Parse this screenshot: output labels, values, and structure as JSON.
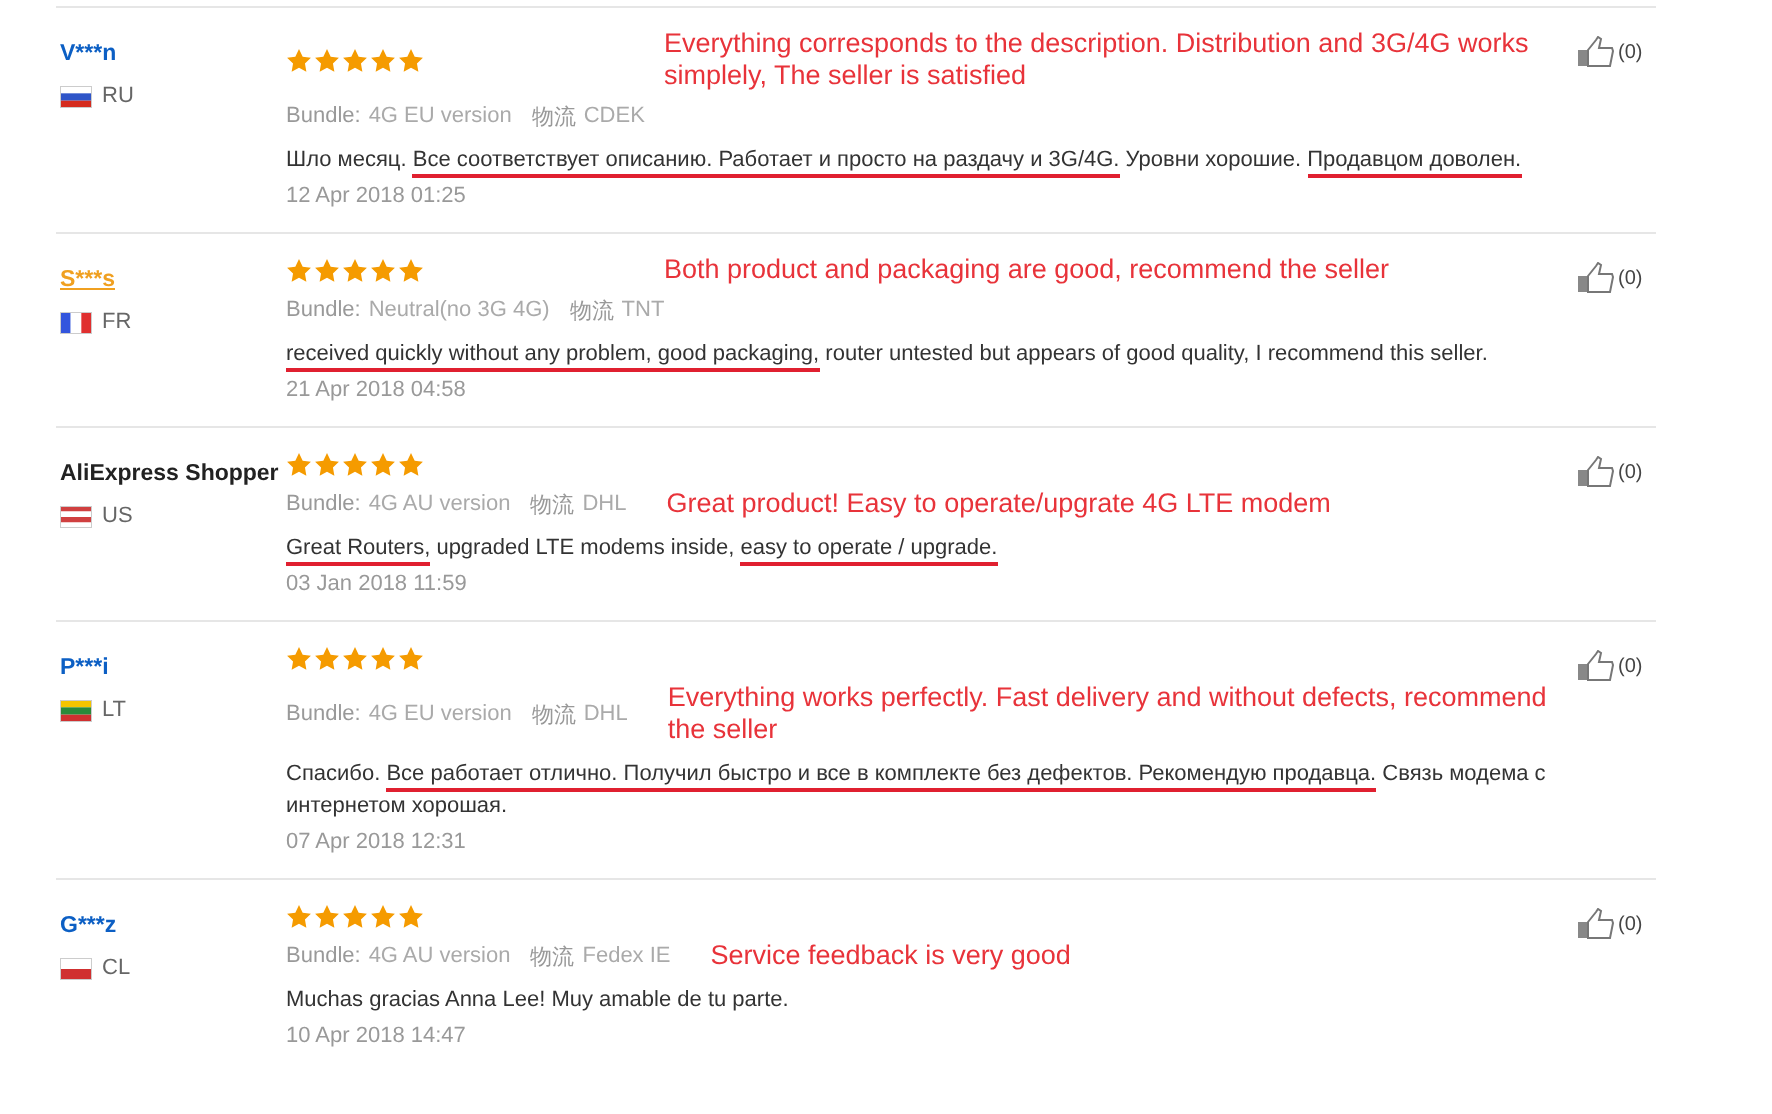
{
  "reviews": [
    {
      "reviewer": {
        "name": "V***n",
        "color": "#0c5fc4",
        "underlined": false,
        "country": "RU",
        "flag": {
          "vertical": false,
          "stripes": [
            {
              "color": "#ffffff"
            },
            {
              "color": "#2f55c8"
            },
            {
              "color": "#d52b1e"
            }
          ]
        }
      },
      "stars": 5,
      "bundle_label": "Bundle:",
      "bundle": "4G EU version",
      "shipping_label": "物流",
      "shipping": "CDEK",
      "annotation": {
        "text": "Everything corresponds to the description. Distribution and 3G/4G works simplely, The seller is satisfied",
        "beside_stars": true
      },
      "text": [
        {
          "text": "Шло месяц. ",
          "underlined": false
        },
        {
          "text": "Все соответствует описанию. ",
          "underlined": true
        },
        {
          "text": "Работает и просто на раздачу и 3G/4G.",
          "underlined": true
        },
        {
          "text": " Уровни хорошие. ",
          "underlined": false
        },
        {
          "text": "Продавцом доволен.",
          "underlined": true
        }
      ],
      "date": "12 Apr 2018 01:25",
      "likes": "(0)"
    },
    {
      "reviewer": {
        "name": "S***s",
        "color": "#f0a020",
        "underlined": true,
        "country": "FR",
        "flag": {
          "vertical": true,
          "stripes": [
            {
              "color": "#3355dd"
            },
            {
              "color": "#ffffff"
            },
            {
              "color": "#e03030"
            }
          ]
        }
      },
      "stars": 5,
      "bundle_label": "Bundle:",
      "bundle": "Neutral(no 3G 4G)",
      "shipping_label": "物流",
      "shipping": "TNT",
      "annotation": {
        "text": "Both product and packaging are good, recommend the seller",
        "beside_stars": true
      },
      "text": [
        {
          "text": "received quickly without any problem, good packaging,",
          "underlined": true
        },
        {
          "text": " router untested but appears of good quality, I recommend this seller.",
          "underlined": false
        }
      ],
      "date": "21 Apr 2018 04:58",
      "likes": "(0)"
    },
    {
      "reviewer": {
        "name": "AliExpress Shopper",
        "color": "#222222",
        "underlined": false,
        "country": "US",
        "flag": {
          "vertical": false,
          "stripes": [
            {
              "color": "#d04040"
            },
            {
              "color": "#ffffff"
            },
            {
              "color": "#d04040"
            },
            {
              "color": "#ffffff"
            }
          ]
        }
      },
      "stars": 5,
      "bundle_label": "Bundle:",
      "bundle": "4G AU version",
      "shipping_label": "物流",
      "shipping": "DHL",
      "annotation": {
        "text": "Great product! Easy to operate/upgrate 4G LTE modem",
        "beside_stars": false
      },
      "text": [
        {
          "text": "Great Routers,",
          "underlined": true
        },
        {
          "text": " upgraded LTE modems inside, ",
          "underlined": false
        },
        {
          "text": "easy to operate / upgrade.",
          "underlined": true
        }
      ],
      "date": "03 Jan 2018 11:59",
      "likes": "(0)"
    },
    {
      "reviewer": {
        "name": "P***i",
        "color": "#0c5fc4",
        "underlined": false,
        "country": "LT",
        "flag": {
          "vertical": false,
          "stripes": [
            {
              "color": "#f5c400"
            },
            {
              "color": "#2a8a3a"
            },
            {
              "color": "#d03030"
            }
          ]
        }
      },
      "stars": 5,
      "bundle_label": "Bundle:",
      "bundle": "4G EU version",
      "shipping_label": "物流",
      "shipping": "DHL",
      "annotation": {
        "text": "Everything works perfectly. Fast delivery and without defects, recommend the seller",
        "beside_stars": false
      },
      "text": [
        {
          "text": "Спасибо. ",
          "underlined": false
        },
        {
          "text": "Все работает отлично. ",
          "underlined": true
        },
        {
          "text": "Получил быстро и все в комплекте без дефектов. Рекомендую продавца.",
          "underlined": true
        },
        {
          "text": " Связь модема с интернетом хорошая.",
          "underlined": false
        }
      ],
      "date": "07 Apr 2018 12:31",
      "likes": "(0)"
    },
    {
      "reviewer": {
        "name": "G***z",
        "color": "#0c5fc4",
        "underlined": false,
        "country": "CL",
        "flag": {
          "vertical": false,
          "stripes": [
            {
              "color": "#ffffff"
            },
            {
              "color": "#d03030"
            }
          ]
        }
      },
      "stars": 5,
      "bundle_label": "Bundle:",
      "bundle": "4G AU version",
      "shipping_label": "物流",
      "shipping": "Fedex IE",
      "annotation": {
        "text": "Service feedback is very good",
        "beside_stars": false
      },
      "text": [
        {
          "text": "Muchas gracias Anna Lee! Muy amable de tu parte.",
          "underlined": false
        }
      ],
      "date": "10 Apr 2018 14:47",
      "likes": "(0)"
    }
  ]
}
